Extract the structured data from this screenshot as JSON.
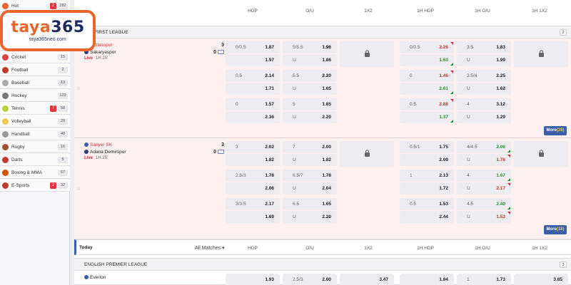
{
  "sidebar": {
    "items": [
      {
        "label": "Hot",
        "live": "2",
        "count": "282",
        "color": "#e8652e"
      },
      {
        "label": "",
        "live": "",
        "count": "",
        "color": "#999"
      },
      {
        "label": "",
        "live": "",
        "count": "",
        "color": "#999"
      },
      {
        "label": "",
        "live": "",
        "count": "",
        "color": "#f0a030"
      },
      {
        "label": "Cricket",
        "live": "",
        "count": "15",
        "color": "#e04040"
      },
      {
        "label": "Football",
        "live": "",
        "count": "2",
        "color": "#c0392b"
      },
      {
        "label": "Baseball",
        "live": "",
        "count": "13",
        "color": "#aaa"
      },
      {
        "label": "Hockey",
        "live": "",
        "count": "123",
        "color": "#777"
      },
      {
        "label": "Tennis",
        "live": "7",
        "count": "58",
        "color": "#b7d335"
      },
      {
        "label": "Volleyball",
        "live": "",
        "count": "29",
        "color": "#f2c94c"
      },
      {
        "label": "Handball",
        "live": "",
        "count": "40",
        "color": "#999"
      },
      {
        "label": "Rugby",
        "live": "",
        "count": "16",
        "color": "#a0522d"
      },
      {
        "label": "Darts",
        "live": "",
        "count": "5",
        "color": "#c0392b"
      },
      {
        "label": "Boxing & MMA",
        "live": "",
        "count": "67",
        "color": "#d35400"
      },
      {
        "label": "E-Sports",
        "live": "2",
        "count": "32",
        "color": "#c0392b"
      }
    ]
  },
  "logo": {
    "brand_a": "taya",
    "brand_b": "365",
    "domain": "taya365neo.com"
  },
  "columns": [
    "HDP",
    "O/U",
    "1X2",
    "1H HDP",
    "1H O/U",
    "1H 1X2"
  ],
  "league1": {
    "name": "KEY FIRST LEAGUE",
    "count": "2"
  },
  "match1": {
    "home": "Tuzlasspor",
    "away": "Sakaryaspor",
    "home_score": "3",
    "away_score": "0",
    "live": "Live",
    "time": "1H 25'",
    "more": "More",
    "more_count": "(28)",
    "rows": [
      [
        [
          "0/0.5",
          "1.87"
        ],
        [
          "5/5.5",
          "1.96"
        ],
        [
          "0/0.5",
          "2.26"
        ],
        [
          "3.5",
          "1.83"
        ]
      ],
      [
        [
          "",
          "1.97"
        ],
        [
          "U",
          "1.86"
        ],
        [
          "",
          "1.63"
        ],
        [
          "U",
          "1.99"
        ]
      ],
      [
        [
          "0.5",
          "2.14"
        ],
        [
          "5.5",
          "2.20"
        ],
        [
          "0",
          "1.46"
        ],
        [
          "3.5/4",
          "2.25"
        ]
      ],
      [
        [
          "",
          "1.71"
        ],
        [
          "U",
          "1.65"
        ],
        [
          "",
          "2.61"
        ],
        [
          "U",
          "1.62"
        ]
      ],
      [
        [
          "0",
          "1.57"
        ],
        [
          "5",
          "1.65"
        ],
        [
          "0.5",
          "2.88"
        ],
        [
          "4",
          "3.12"
        ]
      ],
      [
        [
          "",
          "2.36"
        ],
        [
          "U",
          "2.20"
        ],
        [
          "",
          "1.37"
        ],
        [
          "U",
          "1.29"
        ]
      ]
    ]
  },
  "match2": {
    "home": "Sariyer SK",
    "away": "Adana Demirspor",
    "home_score": "3",
    "away_score": "0",
    "live": "Live",
    "time": "1H 25'",
    "more": "More",
    "more_count": "(18)",
    "rows": [
      [
        [
          "3",
          "2.02"
        ],
        [
          "7",
          "2.00"
        ],
        [
          "0.5/1",
          "1.75"
        ],
        [
          "4/4.5",
          "2.06"
        ]
      ],
      [
        [
          "",
          "1.82"
        ],
        [
          "U",
          "1.82"
        ],
        [
          "",
          "2.09"
        ],
        [
          "U",
          "1.76"
        ]
      ],
      [
        [
          "2.5/3",
          "1.78"
        ],
        [
          "6.5/7",
          "1.78"
        ],
        [
          "1",
          "2.13"
        ],
        [
          "4",
          "1.67"
        ]
      ],
      [
        [
          "",
          "2.06"
        ],
        [
          "U",
          "2.04"
        ],
        [
          "",
          "1.72"
        ],
        [
          "U",
          "2.17"
        ]
      ],
      [
        [
          "3/3.5",
          "2.17"
        ],
        [
          "6.5",
          "1.65"
        ],
        [
          "0.5",
          "1.53"
        ],
        [
          "4.5",
          "2.40"
        ]
      ],
      [
        [
          "",
          "1.69"
        ],
        [
          "U",
          "2.20"
        ],
        [
          "",
          "2.44"
        ],
        [
          "U",
          "1.53"
        ]
      ]
    ]
  },
  "today": {
    "label": "Today",
    "all_matches": "All Matches ▾"
  },
  "league2": {
    "name": "ENGLISH PREMIER LEAGUE",
    "count": "3"
  },
  "match3": {
    "home": "Everton",
    "odds": [
      [
        "",
        "1.93"
      ],
      [
        "2.5/3",
        "2.00"
      ],
      [
        "",
        "3.47"
      ],
      [
        "",
        "1.84"
      ],
      [
        "1",
        "1.73"
      ],
      [
        "",
        "3.85"
      ]
    ]
  },
  "colors": {
    "accent": "#3c5ea8",
    "live_red": "#d42c33",
    "up_green": "#1a9a2e",
    "brand_orange": "#e8652e"
  }
}
